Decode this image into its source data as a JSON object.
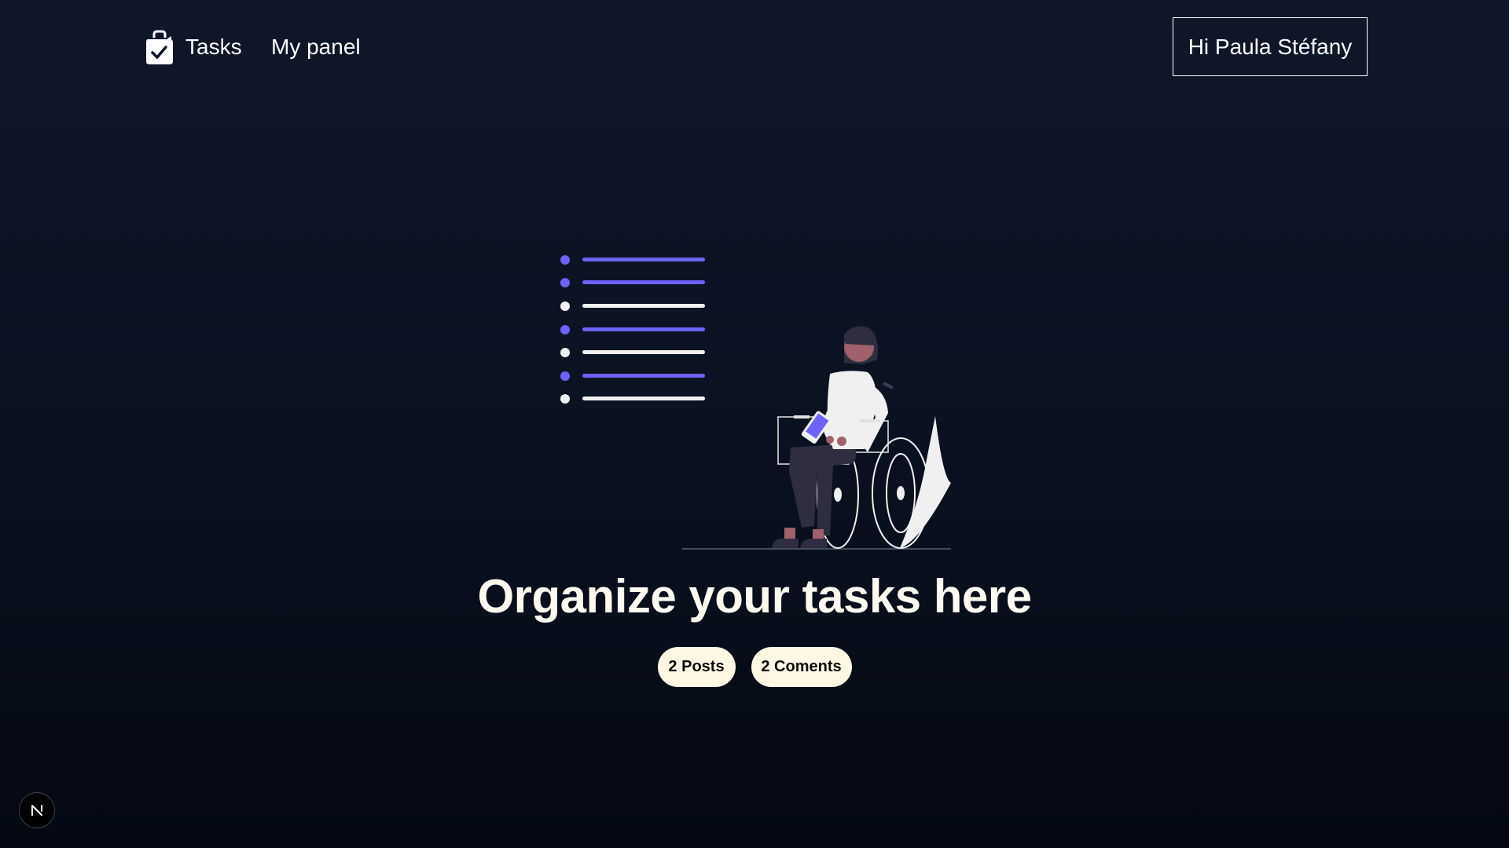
{
  "header": {
    "brand_label": "Tasks",
    "nav_panel_label": "My panel",
    "user_greeting": "Hi Paula Stéfany"
  },
  "hero": {
    "title": "Organize your tasks here",
    "badges": [
      {
        "label": "2 Posts"
      },
      {
        "label": "2 Coments"
      }
    ]
  },
  "colors": {
    "background_top": "#0f1729",
    "background_bottom": "#040913",
    "accent_purple": "#6c63ff",
    "badge_bg": "#fdf7e4",
    "title_color": "#fdfaf0"
  },
  "icons": {
    "brand": "clipboard-check-icon",
    "next": "nextjs-logo-icon"
  }
}
